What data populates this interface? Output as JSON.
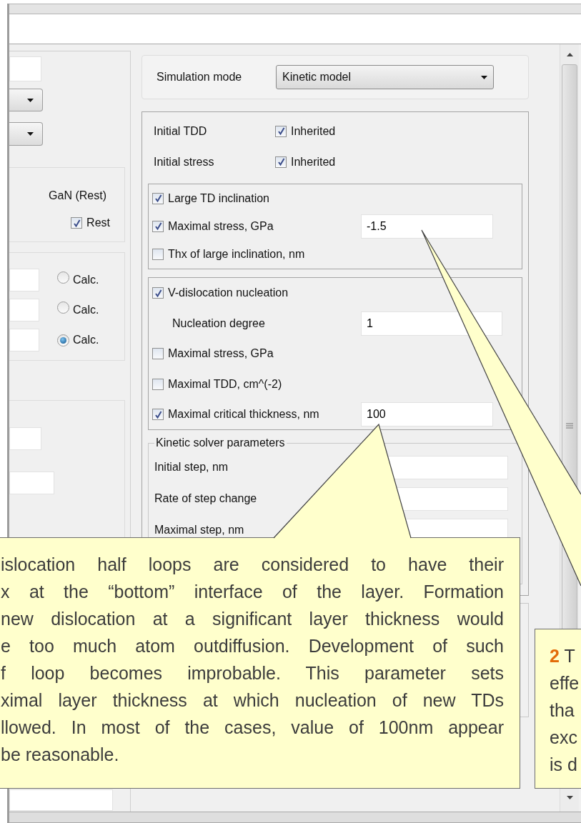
{
  "left_panel": {
    "group_title": "GaN (Rest)",
    "rest_checkbox": {
      "label": "Rest",
      "checked": true
    },
    "calc_options": [
      {
        "label": "Calc.",
        "selected": false
      },
      {
        "label": "Calc.",
        "selected": false
      },
      {
        "label": "Calc.",
        "selected": true
      }
    ]
  },
  "simulation_mode": {
    "label": "Simulation mode",
    "value": "Kinetic model"
  },
  "inherited_rows": [
    {
      "label": "Initial TDD",
      "option": "Inherited",
      "checked": true
    },
    {
      "label": "Initial stress",
      "option": "Inherited",
      "checked": true
    }
  ],
  "inclination_group": [
    {
      "label": "Large TD inclination",
      "checked": true
    },
    {
      "label": "Maximal stress, GPa",
      "checked": true,
      "value": "-1.5"
    },
    {
      "label": "Thx of large inclination, nm",
      "checked": false
    }
  ],
  "nucleation_group": [
    {
      "kind": "checkbox",
      "label": "V-dislocation nucleation",
      "checked": true
    },
    {
      "kind": "field",
      "label": "Nucleation degree",
      "value": "1"
    },
    {
      "kind": "checkbox",
      "label": "Maximal stress, GPa",
      "checked": false
    },
    {
      "kind": "checkbox",
      "label": "Maximal TDD, cm^(-2)",
      "checked": false
    },
    {
      "kind": "checkbox",
      "label": "Maximal critical thickness, nm",
      "checked": true,
      "value": "100"
    }
  ],
  "kinetic_solver": {
    "title": "Kinetic solver parameters",
    "rows": [
      "Initial step, nm",
      "Rate of step change",
      "Maximal step, nm"
    ]
  },
  "callouts": [
    {
      "lines": [
        "islocation half loops are considered to have their",
        "x at the “bottom” interface of the layer. Formation",
        "new dislocation at a significant layer thickness would",
        "e too much atom outdiffusion. Development of such",
        "f loop becomes improbable. This parameter sets",
        "ximal layer thickness at which nucleation of new TDs",
        "llowed. In most of the cases, value of 100nm appear",
        "be reasonable."
      ]
    },
    {
      "number": "2",
      "lines": [
        "T",
        "effe",
        "tha",
        "exc",
        "is d"
      ]
    }
  ]
}
